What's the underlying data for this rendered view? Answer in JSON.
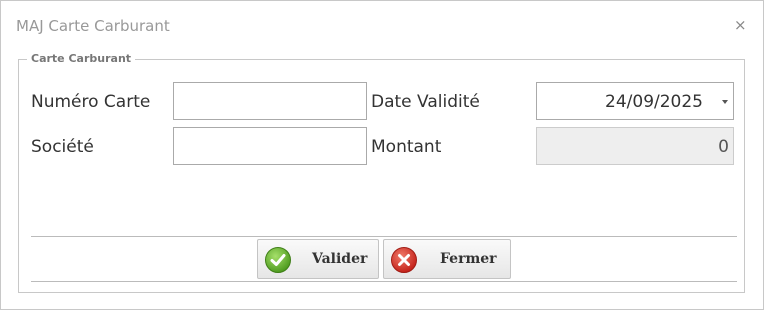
{
  "dialog": {
    "title": "MAJ Carte Carburant",
    "close_glyph": "×",
    "section_legend": "Carte Carburant"
  },
  "form": {
    "numero_carte": {
      "label": "Numéro Carte",
      "value": ""
    },
    "societe": {
      "label": "Société",
      "value": ""
    },
    "date_validite": {
      "label": "Date Validité",
      "value": "24/09/2025"
    },
    "montant": {
      "label": "Montant",
      "value": "0"
    }
  },
  "buttons": {
    "valider": {
      "label": "Valider",
      "icon": "check-circle-icon",
      "color": "#5fae2b"
    },
    "fermer": {
      "label": "Fermer",
      "icon": "x-circle-icon",
      "color": "#d9352b"
    }
  }
}
